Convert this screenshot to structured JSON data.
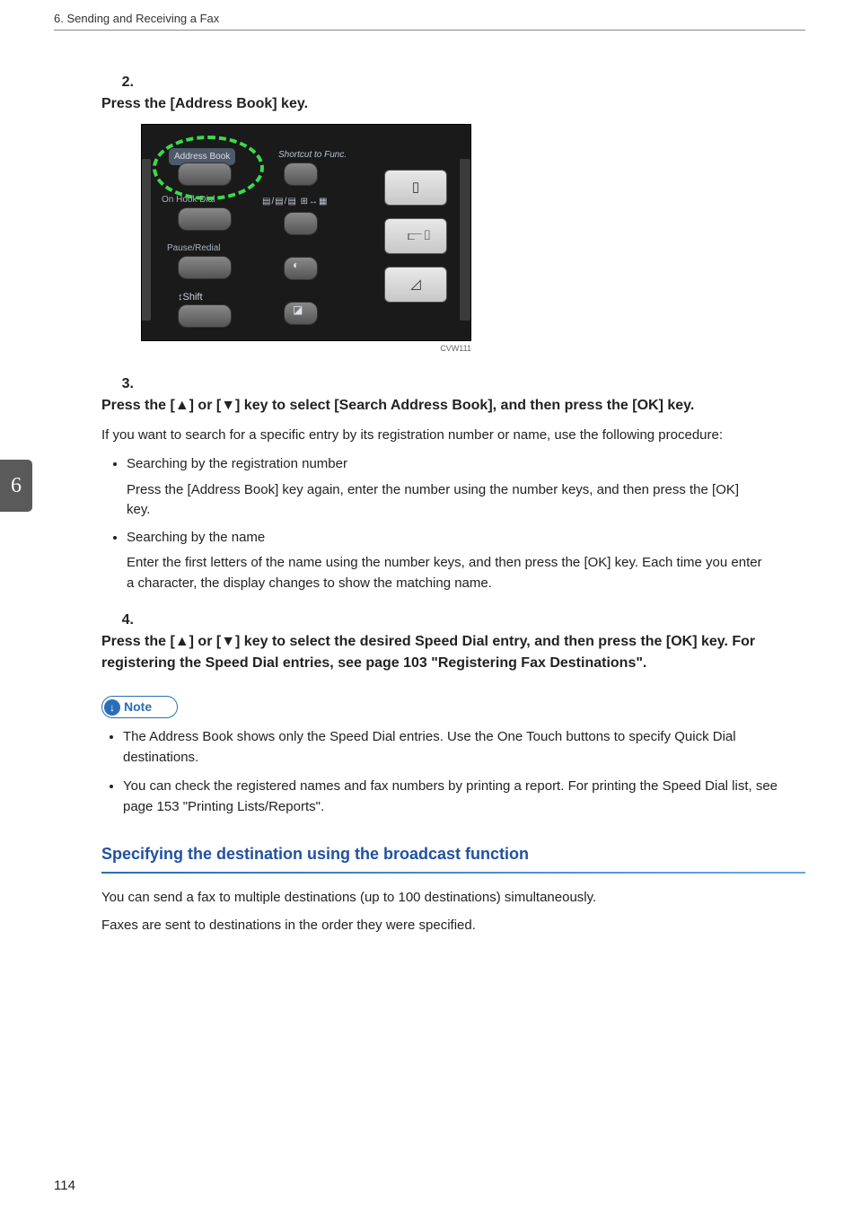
{
  "header": {
    "chapter_title": "6. Sending and Receiving a Fax",
    "tab_number": "6",
    "page_number": "114"
  },
  "steps": [
    {
      "num": "2.",
      "heading": "Press the [Address Book] key.",
      "image_caption": "CVW111"
    },
    {
      "num": "3.",
      "heading": "Press the [▲] or [▼] key to select [Search Address Book], and then press the [OK] key.",
      "para": "If you want to search for a specific entry by its registration number or name, use the following procedure:",
      "bullets": [
        {
          "title": "Searching by the registration number",
          "body": "Press the [Address Book] key again, enter the number using the number keys, and then press the [OK] key."
        },
        {
          "title": "Searching by the name",
          "body": "Enter the first letters of the name using the number keys, and then press the [OK] key. Each time you enter a character, the display changes to show the matching name."
        }
      ]
    },
    {
      "num": "4.",
      "heading_pre": "Press the [▲] or [▼] key to select the desired Speed Dial entry, and then press the [OK] key. For registering the Speed Dial entries, see ",
      "heading_link": "page 103 \"Registering Fax Destinations\"",
      "heading_post": "."
    }
  ],
  "panel": {
    "address_book": "Address Book",
    "shortcut": "Shortcut to Func.",
    "on_hook": "On Hook Dial",
    "icons_row": "▤/▤/▤ ⊞↔▦",
    "pause": "Pause/Redial",
    "shift": "↕Shift",
    "mid_glyph_contrast": "◐",
    "mid_glyph_mem": "◪"
  },
  "note": {
    "label": "Note",
    "items": [
      "The Address Book shows only the Speed Dial entries. Use the One Touch buttons to specify Quick Dial destinations.",
      "You can check the registered names and fax numbers by printing a report. For printing the Speed Dial list, see page 153 \"Printing Lists/Reports\"."
    ]
  },
  "subsection": {
    "title": "Specifying the destination using the broadcast function",
    "paras": [
      "You can send a fax to multiple destinations (up to 100 destinations) simultaneously.",
      "Faxes are sent to destinations in the order they were specified."
    ]
  }
}
